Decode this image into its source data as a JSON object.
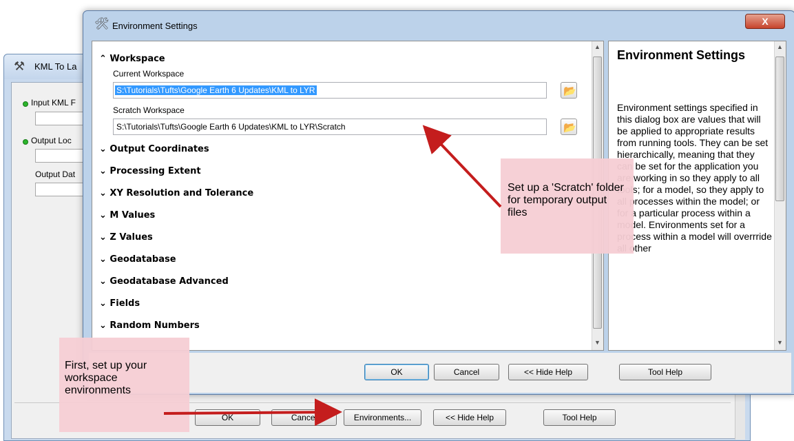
{
  "background_window": {
    "title": "KML To La",
    "fields": [
      {
        "label": "Input KML F",
        "required": true
      },
      {
        "label": "Output Loc",
        "required": true
      },
      {
        "label": "Output Dat",
        "required": false
      }
    ],
    "buttons": {
      "ok": "OK",
      "cancel": "Cancel",
      "environments": "Environments...",
      "hide_help": "<< Hide Help",
      "tool_help": "Tool Help"
    }
  },
  "dialog": {
    "title": "Environment Settings",
    "close_label": "X",
    "workspace": {
      "header": "Workspace",
      "current_label": "Current Workspace",
      "current_value": "S:\\Tutorials\\Tufts\\Google Earth 6 Updates\\KML to LYR",
      "scratch_label": "Scratch Workspace",
      "scratch_value": "S:\\Tutorials\\Tufts\\Google Earth 6 Updates\\KML to LYR\\Scratch"
    },
    "sections": [
      "Output Coordinates",
      "Processing Extent",
      "XY Resolution and Tolerance",
      "M Values",
      "Z Values",
      "Geodatabase",
      "Geodatabase Advanced",
      "Fields",
      "Random Numbers"
    ],
    "help": {
      "title": "Environment Settings",
      "body": "Environment settings specified in this dialog box are values that will be applied to appropriate results from running tools. They can be set hierarchically, meaning that they can be set for the application you are working in so they apply to all tools; for a model, so they apply to all processes within the model; or for a particular process within a model. Environments set for a process within a model will overrride all other"
    },
    "buttons": {
      "ok": "OK",
      "cancel": "Cancel",
      "hide_help": "<< Hide Help",
      "tool_help": "Tool Help"
    }
  },
  "callouts": {
    "scratch": "Set up a 'Scratch' folder for temporary output files",
    "first": "First, set up your workspace environments"
  },
  "colors": {
    "arrow": "#c41d1d",
    "callout_bg": "#f5cdd4",
    "selection": "#3399ff"
  }
}
